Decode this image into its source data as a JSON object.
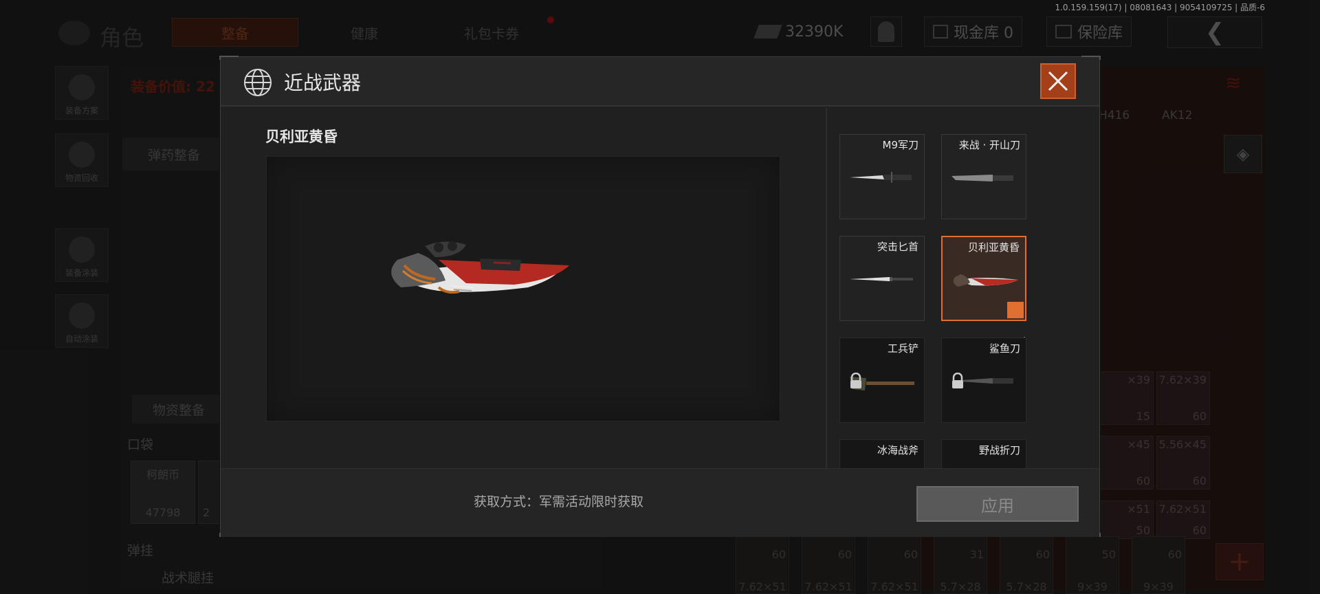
{
  "version": "1.0.159.159(17) | 08081643 | 9054109725 | 品质-6",
  "background": {
    "title": "角色",
    "tabs": [
      "整备",
      "健康",
      "礼包卡券"
    ],
    "currency": "32390K",
    "cash_vault": "现金库 0",
    "safe_vault": "保险库",
    "left_icons": [
      "装备方案",
      "物资回收",
      "装备涂装",
      "自动涂装"
    ],
    "equip_value": "装备价值: 22",
    "ammo_prep": "弹药整备",
    "supply_prep": "物资整备",
    "pocket": "口袋",
    "cash_label": "柯朗币",
    "cash_amount": "47798",
    "cash_amount2": "2",
    "grenade": "弹挂",
    "tactical": "战术腿挂",
    "right_weapons": [
      "H416",
      "AK12"
    ],
    "ammo_cells": [
      {
        "cal": "×39",
        "cnt": "15"
      },
      {
        "cal": "7.62×39",
        "cnt": "60"
      },
      {
        "cal": "×45",
        "cnt": "60"
      },
      {
        "cal": "5.56×45",
        "cnt": "60"
      },
      {
        "cal": "×51",
        "cnt": "50"
      },
      {
        "cal": "7.62×51",
        "cnt": "60"
      }
    ],
    "bottom_cells": [
      {
        "cnt": "60",
        "cal": "7.62×51"
      },
      {
        "cnt": "60",
        "cal": "7.62×51"
      },
      {
        "cnt": "60",
        "cal": "7.62×51"
      },
      {
        "cnt": "31",
        "cal": "5.7×28"
      },
      {
        "cnt": "60",
        "cal": "5.7×28"
      },
      {
        "cnt": "50",
        "cal": "9×39"
      },
      {
        "cnt": "60",
        "cal": "9×39"
      }
    ]
  },
  "modal": {
    "title": "近战武器",
    "selected_name": "贝利亚黄昏",
    "weapons": [
      {
        "name": "M9军刀",
        "locked": false,
        "selected": false,
        "color": "#c8c8c8"
      },
      {
        "name": "来战 · 开山刀",
        "locked": false,
        "selected": false,
        "color": "#b0b0b0"
      },
      {
        "name": "突击匕首",
        "locked": false,
        "selected": false,
        "color": "#d0d0d0"
      },
      {
        "name": "贝利亚黄昏",
        "locked": false,
        "selected": true,
        "color": "#c83a2a"
      },
      {
        "name": "工兵铲",
        "locked": true,
        "selected": false,
        "color": "#6a5a44"
      },
      {
        "name": "鲨鱼刀",
        "locked": true,
        "selected": false,
        "color": "#8a8a8a"
      },
      {
        "name": "冰海战斧",
        "locked": true,
        "selected": false,
        "color": "#888888"
      },
      {
        "name": "野战折刀",
        "locked": true,
        "selected": false,
        "color": "#888888"
      }
    ],
    "acquire_text": "获取方式：军需活动限时获取",
    "apply_label": "应用",
    "accent_color": "#e07030"
  }
}
